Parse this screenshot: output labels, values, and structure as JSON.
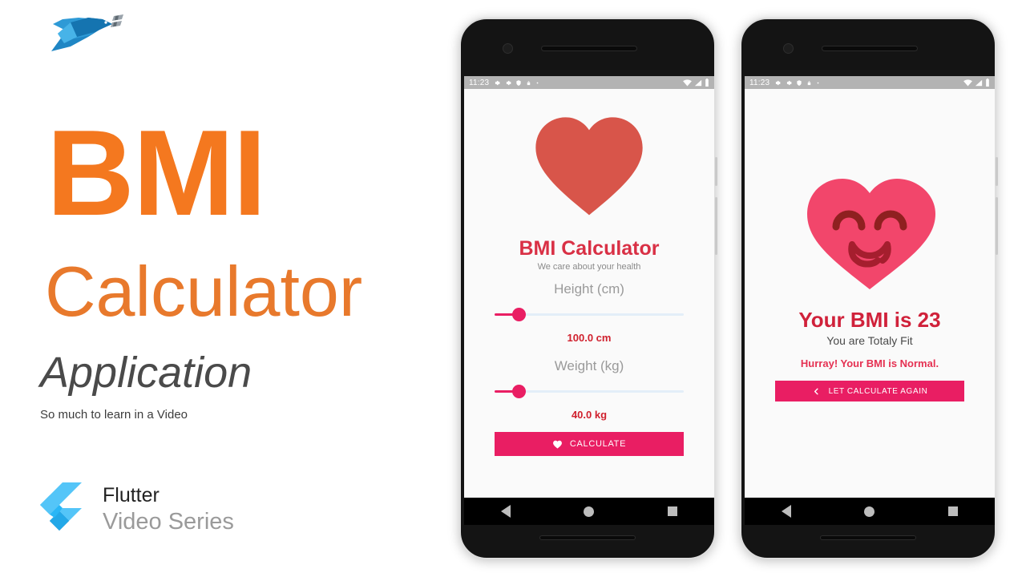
{
  "promo": {
    "logo_icon": "bird-logo-icon",
    "title_main": "BMI",
    "title_sub": "Calculator",
    "title_third": "Application",
    "tagline": "So much to learn in a Video",
    "framework_name": "Flutter",
    "framework_series": "Video Series",
    "framework_icon": "flutter-logo-icon",
    "colors": {
      "orange_bold": "#F4781F",
      "orange_light": "#E8792C",
      "grey_text": "#4a4a4a",
      "flutter_blue": "#54C5F8"
    }
  },
  "phone1": {
    "status_bar": {
      "time": "11:23",
      "left_icons": [
        "gear-icon",
        "gear-icon",
        "shield-icon",
        "lock-icon",
        "dot-icon"
      ],
      "right_icons": [
        "wifi-icon",
        "signal-icon",
        "battery-icon"
      ]
    },
    "screen": {
      "hero_icon": "heart-icon",
      "hero_color": "#D8554A",
      "app_title": "BMI Calculator",
      "app_subtitle": "We care about your health",
      "height_label": "Height (cm)",
      "height_value": "100.0 cm",
      "weight_label": "Weight (kg)",
      "weight_value": "40.0 kg",
      "calculate_button": "CALCULATE",
      "calculate_icon": "heart-icon",
      "accent_color": "#E91E63"
    },
    "nav_bar": {
      "back": "back-triangle-icon",
      "home": "home-circle-icon",
      "recents": "recents-square-icon"
    }
  },
  "phone2": {
    "status_bar": {
      "time": "11:23",
      "left_icons": [
        "gear-icon",
        "gear-icon",
        "shield-icon",
        "lock-icon",
        "dot-icon"
      ],
      "right_icons": [
        "wifi-icon",
        "signal-icon",
        "battery-icon"
      ]
    },
    "screen": {
      "hero_icon": "smiling-heart-face-icon",
      "hero_color": "#F2466B",
      "result_title": "Your BMI is 23",
      "result_status": "You are Totaly Fit",
      "result_message": "Hurray! Your BMI is Normal.",
      "again_button": "LET CALCULATE AGAIN",
      "again_icon": "chevron-left-icon",
      "accent_color": "#E91E63"
    },
    "nav_bar": {
      "back": "back-triangle-icon",
      "home": "home-circle-icon",
      "recents": "recents-square-icon"
    }
  }
}
